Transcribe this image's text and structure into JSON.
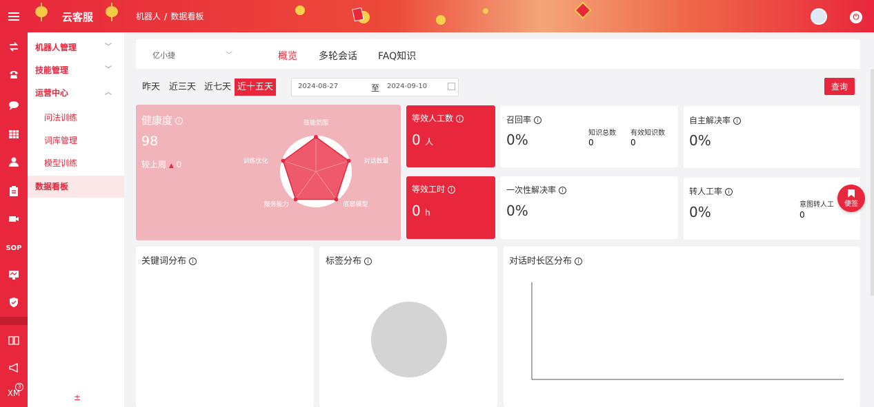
{
  "header": {
    "brand": "云客服",
    "breadcrumb": [
      "机器人",
      "数据看板"
    ],
    "breadcrumb_sep": "/"
  },
  "rail": {
    "icons": [
      "transfer-icon",
      "phone-icon",
      "chat-icon",
      "grid-icon",
      "user-icon",
      "clipboard-icon",
      "video-icon",
      "sop-icon",
      "monitor-icon",
      "shield-icon",
      "book-icon",
      "megaphone-icon",
      "xm-icon"
    ],
    "sop_label": "SOP",
    "xm_label": "XM",
    "xm_badge": "3"
  },
  "submenu": {
    "robot_mgmt": "机器人管理",
    "skill_mgmt": "技能管理",
    "ops_center": "运营中心",
    "qa_training": "问法训练",
    "lexicon": "词库管理",
    "model_training": "模型训练",
    "dashboard": "数据看板",
    "bottom": "±"
  },
  "toolbar": {
    "bot_select": "亿小捷",
    "tabs": [
      "概览",
      "多轮会话",
      "FAQ知识"
    ],
    "active_tab": 0
  },
  "filters": {
    "ranges": [
      "昨天",
      "近三天",
      "近七天",
      "近十五天"
    ],
    "active_range": 3,
    "start_date": "2024-08-27",
    "to": "至",
    "end_date": "2024-09-10",
    "query_label": "查询"
  },
  "health": {
    "title": "健康度",
    "score": "98",
    "compare_label": "较上周",
    "compare_value": "0",
    "radar_labels": [
      "技能范围",
      "对话数量",
      "底层模型",
      "服务能力",
      "训练优化"
    ],
    "radar_values": [
      1.0,
      1.0,
      1.0,
      1.0,
      1.0
    ]
  },
  "metrics": {
    "equiv_staff": {
      "title": "等效人工数",
      "value": "0",
      "unit": "人"
    },
    "equiv_hours": {
      "title": "等效工时",
      "value": "0",
      "unit": "h"
    },
    "recall": {
      "title": "召回率",
      "value": "0%",
      "k_total_label": "知识总数",
      "k_total": "0",
      "k_valid_label": "有效知识数",
      "k_valid": "0"
    },
    "self_resolve": {
      "title": "自主解决率",
      "value": "0%"
    },
    "first_resolve": {
      "title": "一次性解决率",
      "value": "0%"
    },
    "transfer": {
      "title": "转人工率",
      "value": "0%",
      "intent_label": "意图转人工",
      "intent_value": "0"
    }
  },
  "charts": {
    "keyword": "关键词分布",
    "tag": "标签分布",
    "duration": "对话时长区分布"
  },
  "fab_label": "便签",
  "colors": {
    "brand": "#e8263c",
    "health_bg": "#f2b4bb"
  }
}
